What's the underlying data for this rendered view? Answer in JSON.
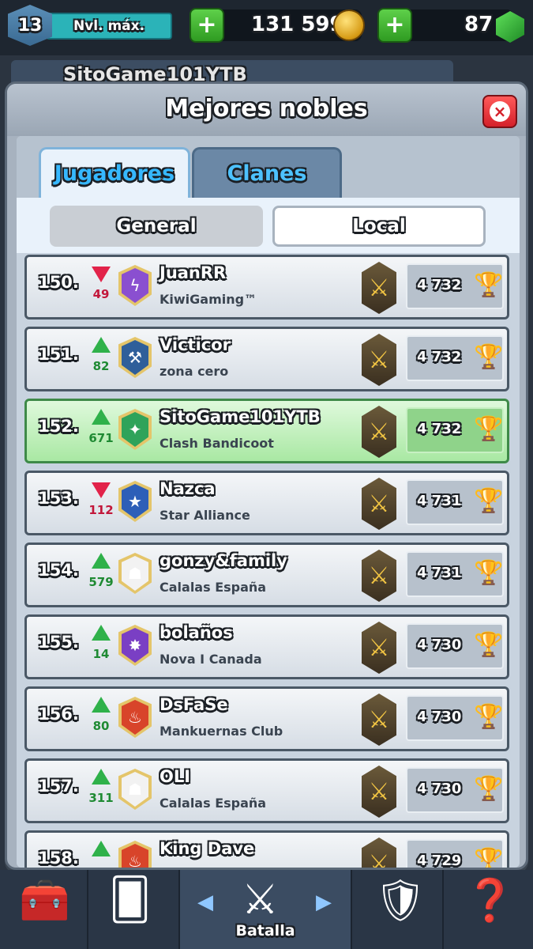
{
  "topbar": {
    "level": "13",
    "level_label": "Nvl. máx.",
    "gold": "131 599",
    "gems": "87",
    "plus_symbol": "+"
  },
  "behind": {
    "player_name": "SitoGame101YTB"
  },
  "modal": {
    "title": "Mejores nobles",
    "close_symbol": "×",
    "tabs": [
      "Jugadores",
      "Clanes"
    ],
    "subtabs": [
      "General",
      "Local"
    ]
  },
  "rows": [
    {
      "rank": "150.",
      "change": "49",
      "dir": "down",
      "name": "JuanRR",
      "clan": "KiwiGaming™",
      "trophies": "4 732",
      "badge_color": "#8a4fd0",
      "badge_icon": "ϟ"
    },
    {
      "rank": "151.",
      "change": "82",
      "dir": "up",
      "name": "Victicor",
      "clan": "zona cero",
      "trophies": "4 732",
      "badge_color": "#2f5f9a",
      "badge_icon": "⚒"
    },
    {
      "rank": "152.",
      "change": "671",
      "dir": "up",
      "name": "SitoGame101YTB",
      "clan": "Clash Bandicoot",
      "trophies": "4 732",
      "badge_color": "#2fa35a",
      "badge_icon": "✦"
    },
    {
      "rank": "153.",
      "change": "112",
      "dir": "down",
      "name": "Nazca",
      "clan": "Star Alliance",
      "trophies": "4 731",
      "badge_color": "#2d5fb8",
      "badge_icon": "★"
    },
    {
      "rank": "154.",
      "change": "579",
      "dir": "up",
      "name": "gonzy&family",
      "clan": "Calalas España",
      "trophies": "4 731",
      "badge_color": "#f2f2f2",
      "badge_icon": "☗"
    },
    {
      "rank": "155.",
      "change": "14",
      "dir": "up",
      "name": "bolaños",
      "clan": "Nova I Canada",
      "trophies": "4 730",
      "badge_color": "#7a3fc4",
      "badge_icon": "✸"
    },
    {
      "rank": "156.",
      "change": "80",
      "dir": "up",
      "name": "DsFaSe",
      "clan": "Mankuernas Club",
      "trophies": "4 730",
      "badge_color": "#d8442a",
      "badge_icon": "♨"
    },
    {
      "rank": "157.",
      "change": "311",
      "dir": "up",
      "name": "OLI",
      "clan": "Calalas España",
      "trophies": "4 730",
      "badge_color": "#f2f2f2",
      "badge_icon": "☗"
    },
    {
      "rank": "158.",
      "change": "",
      "dir": "up",
      "name": "King Dave",
      "clan": "",
      "trophies": "4 729",
      "badge_color": "#d8442a",
      "badge_icon": "♨"
    }
  ],
  "bottom_nav": {
    "battle_label": "Batalla"
  },
  "icons": {
    "rank_icon": "⚔",
    "trophy_icon": "🏆"
  }
}
